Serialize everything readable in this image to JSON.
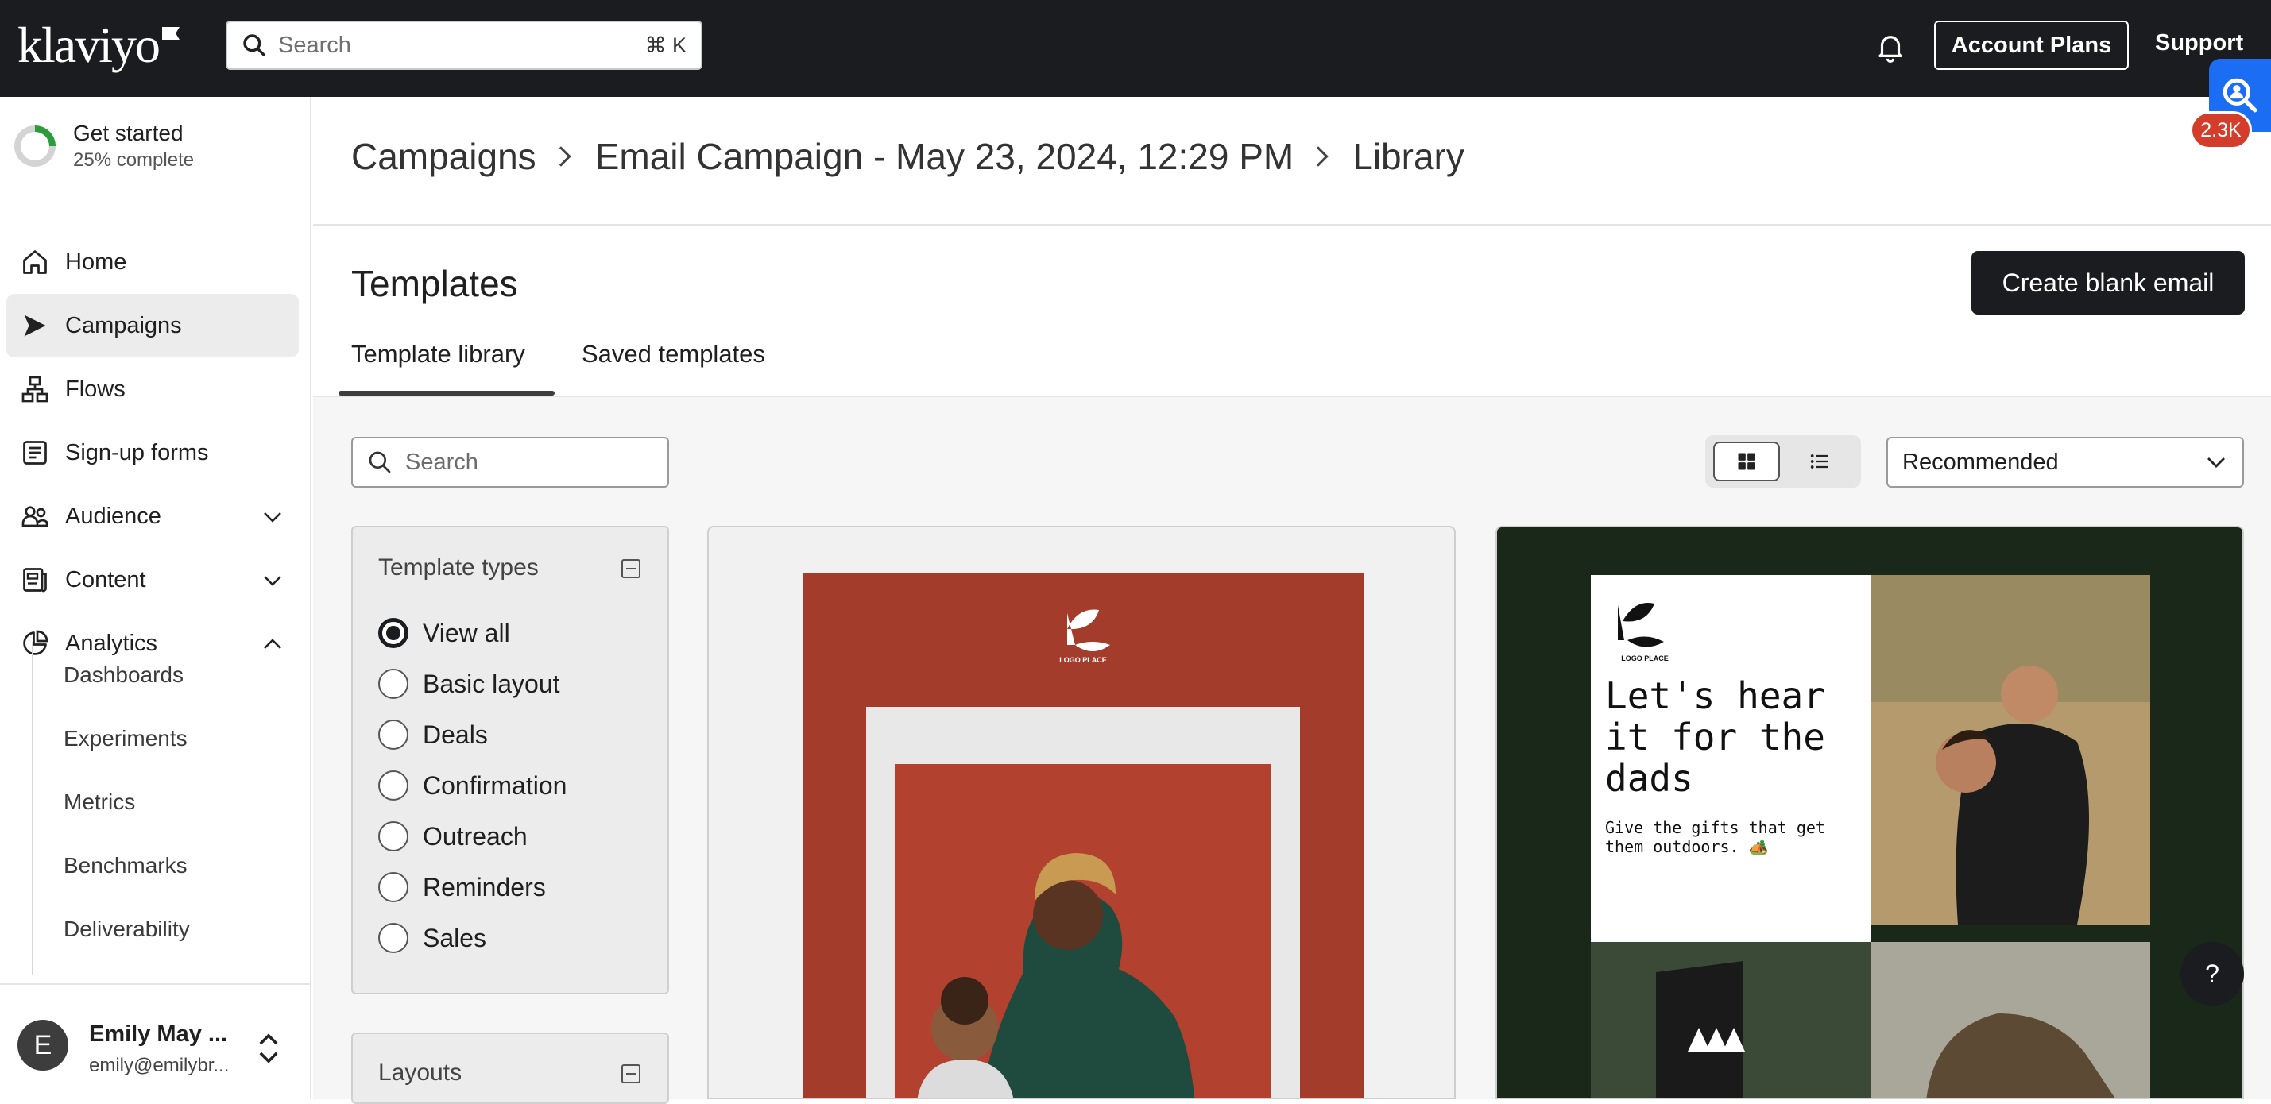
{
  "topbar": {
    "logo_text": "klaviyo",
    "search_placeholder": "Search",
    "search_shortcut": "⌘ K",
    "account_plans": "Account Plans",
    "support": "Support",
    "notification_badge": "2.3K"
  },
  "sidebar": {
    "get_started": {
      "title": "Get started",
      "progress_text": "25% complete",
      "progress": 0.25
    },
    "items": [
      {
        "label": "Home",
        "icon": "home-icon"
      },
      {
        "label": "Campaigns",
        "icon": "send-icon",
        "active": true
      },
      {
        "label": "Flows",
        "icon": "flows-icon"
      },
      {
        "label": "Sign-up forms",
        "icon": "form-icon"
      },
      {
        "label": "Audience",
        "icon": "people-icon"
      },
      {
        "label": "Content",
        "icon": "content-icon"
      },
      {
        "label": "Analytics",
        "icon": "analytics-icon"
      }
    ],
    "analytics_sub": [
      "Dashboards",
      "Experiments",
      "Metrics",
      "Benchmarks",
      "Deliverability"
    ],
    "user": {
      "initial": "E",
      "name": "Emily May ...",
      "email": "emily@emilybr..."
    }
  },
  "breadcrumb": [
    "Campaigns",
    "Email Campaign - May 23, 2024, 12:29 PM",
    "Library"
  ],
  "page": {
    "title": "Templates",
    "create_button": "Create blank email",
    "tabs": [
      "Template library",
      "Saved templates"
    ]
  },
  "library": {
    "search_placeholder": "Search",
    "sort_value": "Recommended",
    "template_types": {
      "heading": "Template types",
      "options": [
        "View all",
        "Basic layout",
        "Deals",
        "Confirmation",
        "Outreach",
        "Reminders",
        "Sales"
      ],
      "selected": "View all"
    },
    "layouts_heading": "Layouts"
  },
  "cards": [
    {
      "logo_text": "LOGO PLACE",
      "accent": "#a33c2b"
    },
    {
      "logo_text": "LOGO PLACE",
      "headline": "Let's hear it for the dads",
      "body": "Give the gifts that get them outdoors. 🏕️",
      "accent": "#192818"
    }
  ],
  "help_label": "?"
}
